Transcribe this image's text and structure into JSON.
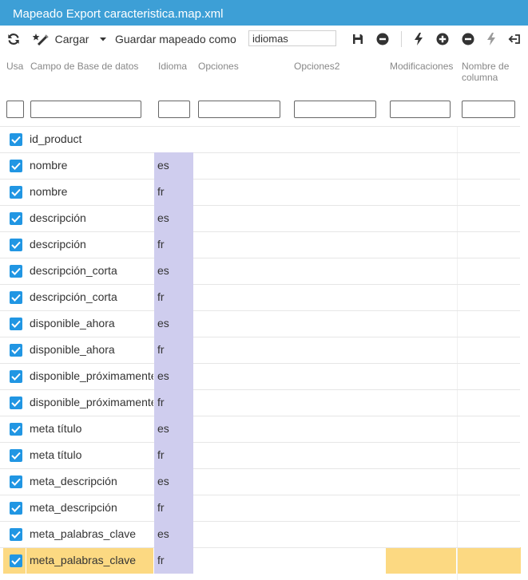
{
  "title": "Mapeado Export caracteristica.map.xml",
  "toolbar": {
    "load_label": "Cargar",
    "save_as_label": "Guardar mapeado como",
    "mapping_name_value": "idiomas"
  },
  "columns": {
    "usa": "Usa",
    "field": "Campo de Base de datos",
    "language": "Idioma",
    "options": "Opciones",
    "options2": "Opciones2",
    "modifications": "Modificaciones",
    "column_name_line1": "Nombre de",
    "column_name_line2": "columna"
  },
  "rows": [
    {
      "field": "id_product",
      "language": "",
      "checked": true
    },
    {
      "field": "nombre",
      "language": "es",
      "checked": true
    },
    {
      "field": "nombre",
      "language": "fr",
      "checked": true
    },
    {
      "field": "descripción",
      "language": "es",
      "checked": true
    },
    {
      "field": "descripción",
      "language": "fr",
      "checked": true
    },
    {
      "field": "descripción_corta",
      "language": "es",
      "checked": true
    },
    {
      "field": "descripción_corta",
      "language": "fr",
      "checked": true
    },
    {
      "field": "disponible_ahora",
      "language": "es",
      "checked": true
    },
    {
      "field": "disponible_ahora",
      "language": "fr",
      "checked": true
    },
    {
      "field": "disponible_próximamente",
      "language": "es",
      "checked": true
    },
    {
      "field": "disponible_próximamente",
      "language": "fr",
      "checked": true
    },
    {
      "field": "meta título",
      "language": "es",
      "checked": true
    },
    {
      "field": "meta título",
      "language": "fr",
      "checked": true
    },
    {
      "field": "meta_descripción",
      "language": "es",
      "checked": true
    },
    {
      "field": "meta_descripción",
      "language": "fr",
      "checked": true
    },
    {
      "field": "meta_palabras_clave",
      "language": "es",
      "checked": true
    },
    {
      "field": "meta_palabras_clave",
      "language": "fr",
      "checked": true,
      "selected": true
    }
  ],
  "colors": {
    "title_bar": "#3d9fd6",
    "checkbox": "#2196e3",
    "language_cell": "#cfcdee",
    "selected_row": "#fcd982"
  },
  "icons": {
    "refresh": "refresh-icon",
    "load": "wand-icon",
    "dropdown": "caret-down-icon",
    "save": "floppy-disk-icon",
    "remove_mapping": "minus-circle-icon",
    "auto_map": "lightning-icon",
    "add_row": "plus-circle-icon",
    "remove_row": "minus-circle-icon",
    "auto_map_disabled": "lightning-icon",
    "exit": "exit-icon"
  }
}
